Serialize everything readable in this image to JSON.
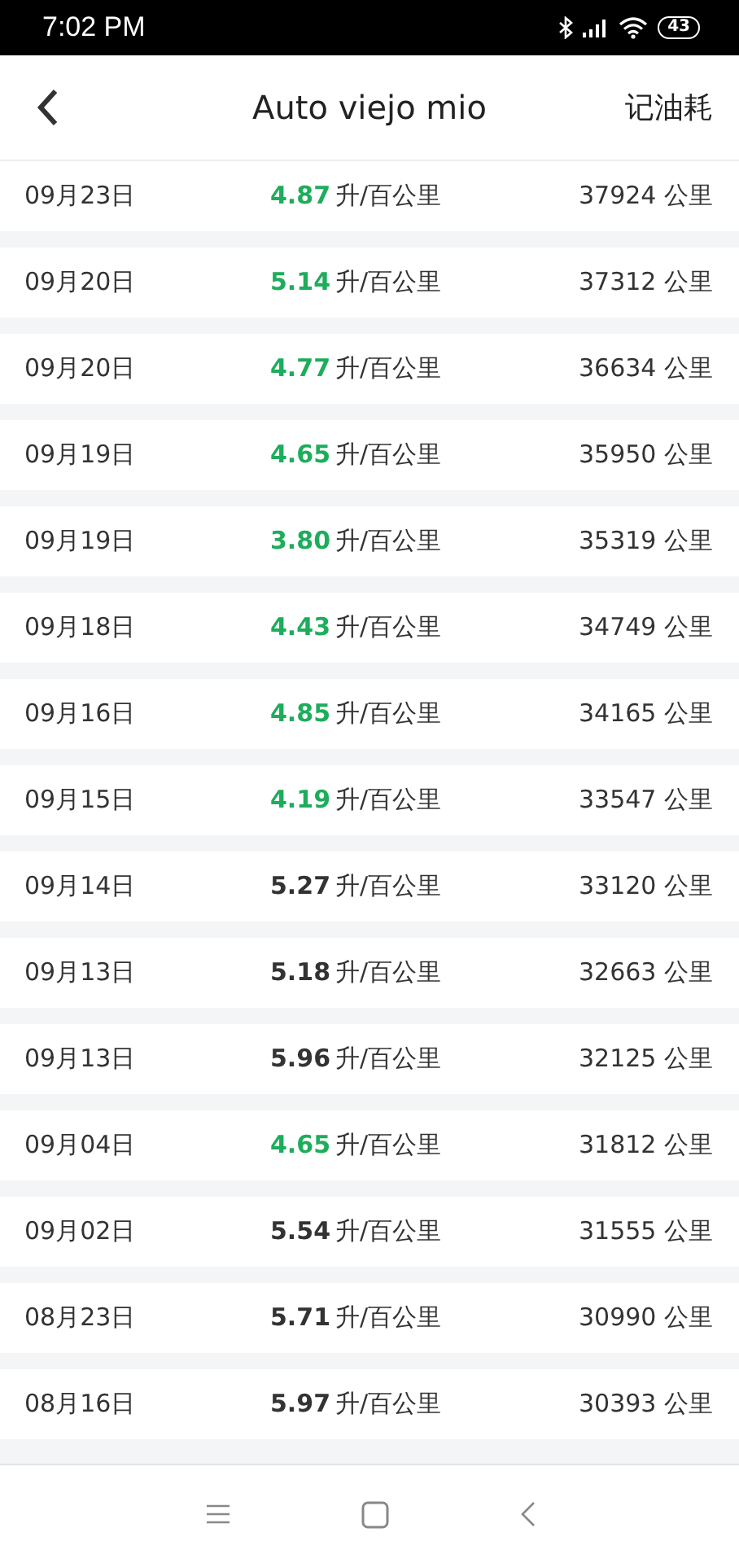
{
  "status_bar": {
    "time": "7:02  PM",
    "battery": "43"
  },
  "header": {
    "title": "Auto viejo mio",
    "action": "记油耗"
  },
  "records": [
    {
      "date": "09月23日",
      "value": "4.87",
      "unit": "升/百公里",
      "good": true,
      "distance": "37924 公里"
    },
    {
      "date": "09月20日",
      "value": "5.14",
      "unit": "升/百公里",
      "good": true,
      "distance": "37312 公里"
    },
    {
      "date": "09月20日",
      "value": "4.77",
      "unit": "升/百公里",
      "good": true,
      "distance": "36634 公里"
    },
    {
      "date": "09月19日",
      "value": "4.65",
      "unit": "升/百公里",
      "good": true,
      "distance": "35950 公里"
    },
    {
      "date": "09月19日",
      "value": "3.80",
      "unit": "升/百公里",
      "good": true,
      "distance": "35319 公里"
    },
    {
      "date": "09月18日",
      "value": "4.43",
      "unit": "升/百公里",
      "good": true,
      "distance": "34749 公里"
    },
    {
      "date": "09月16日",
      "value": "4.85",
      "unit": "升/百公里",
      "good": true,
      "distance": "34165 公里"
    },
    {
      "date": "09月15日",
      "value": "4.19",
      "unit": "升/百公里",
      "good": true,
      "distance": "33547 公里"
    },
    {
      "date": "09月14日",
      "value": "5.27",
      "unit": "升/百公里",
      "good": false,
      "distance": "33120 公里"
    },
    {
      "date": "09月13日",
      "value": "5.18",
      "unit": "升/百公里",
      "good": false,
      "distance": "32663 公里"
    },
    {
      "date": "09月13日",
      "value": "5.96",
      "unit": "升/百公里",
      "good": false,
      "distance": "32125 公里"
    },
    {
      "date": "09月04日",
      "value": "4.65",
      "unit": "升/百公里",
      "good": true,
      "distance": "31812 公里"
    },
    {
      "date": "09月02日",
      "value": "5.54",
      "unit": "升/百公里",
      "good": false,
      "distance": "31555 公里"
    },
    {
      "date": "08月23日",
      "value": "5.71",
      "unit": "升/百公里",
      "good": false,
      "distance": "30990 公里"
    },
    {
      "date": "08月16日",
      "value": "5.97",
      "unit": "升/百公里",
      "good": false,
      "distance": "30393 公里"
    }
  ]
}
